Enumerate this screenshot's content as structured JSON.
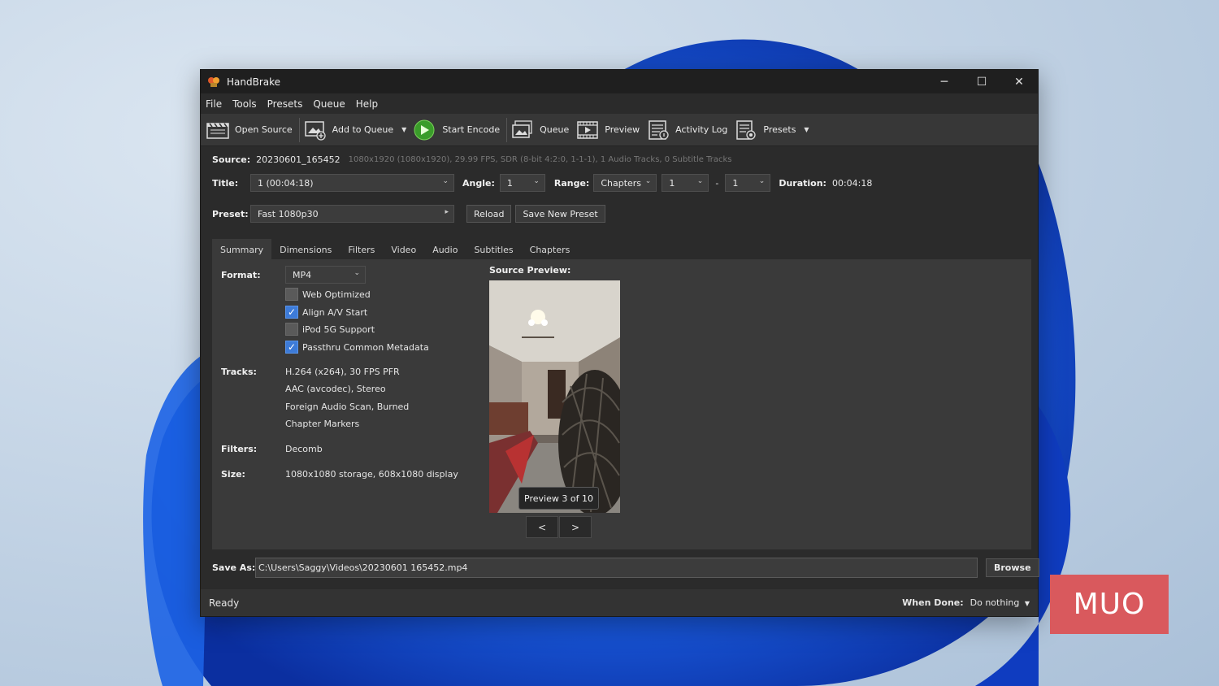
{
  "window": {
    "title": "HandBrake",
    "controls": {
      "minimize": "─",
      "maximize": "☐",
      "close": "✕"
    }
  },
  "menu": [
    "File",
    "Tools",
    "Presets",
    "Queue",
    "Help"
  ],
  "toolbar": {
    "open_source": "Open Source",
    "add_to_queue": "Add to Queue",
    "start_encode": "Start Encode",
    "queue": "Queue",
    "preview": "Preview",
    "activity_log": "Activity Log",
    "presets": "Presets"
  },
  "source": {
    "label": "Source:",
    "name": "20230601_165452",
    "info": "1080x1920 (1080x1920), 29.99 FPS, SDR (8-bit 4:2:0, 1-1-1), 1 Audio Tracks, 0 Subtitle Tracks"
  },
  "title_row": {
    "title_label": "Title:",
    "title_value": "1  (00:04:18)",
    "angle_label": "Angle:",
    "angle_value": "1",
    "range_label": "Range:",
    "range_value": "Chapters",
    "range_start": "1",
    "range_dash": "-",
    "range_end": "1",
    "duration_label": "Duration:",
    "duration_value": "00:04:18"
  },
  "preset_row": {
    "label": "Preset:",
    "value": "Fast 1080p30",
    "reload": "Reload",
    "save_new": "Save New Preset"
  },
  "tabs": [
    "Summary",
    "Dimensions",
    "Filters",
    "Video",
    "Audio",
    "Subtitles",
    "Chapters"
  ],
  "summary": {
    "format_label": "Format:",
    "format_value": "MP4",
    "checkboxes": [
      {
        "label": "Web Optimized",
        "checked": false
      },
      {
        "label": "Align A/V Start",
        "checked": true
      },
      {
        "label": "iPod 5G Support",
        "checked": false
      },
      {
        "label": "Passthru Common Metadata",
        "checked": true
      }
    ],
    "tracks_label": "Tracks:",
    "tracks": [
      "H.264 (x264), 30 FPS PFR",
      "AAC (avcodec), Stereo",
      "Foreign Audio Scan, Burned",
      "Chapter Markers"
    ],
    "filters_label": "Filters:",
    "filters_value": "Decomb",
    "size_label": "Size:",
    "size_value": "1080x1080 storage, 608x1080 display",
    "preview_label": "Source Preview:",
    "preview_badge": "Preview 3 of 10",
    "prev": "<",
    "next": ">"
  },
  "save_as": {
    "label": "Save As:",
    "path": "C:\\Users\\Saggy\\Videos\\20230601 165452.mp4",
    "browse": "Browse"
  },
  "status": {
    "text": "Ready",
    "when_done_label": "When Done:",
    "when_done_value": "Do nothing"
  },
  "watermark": "MUO",
  "colors": {
    "accent": "#3d7bd8",
    "window_bg": "#2b2b2b",
    "panel_bg": "#3a3a3a",
    "watermark": "#d9595d"
  }
}
